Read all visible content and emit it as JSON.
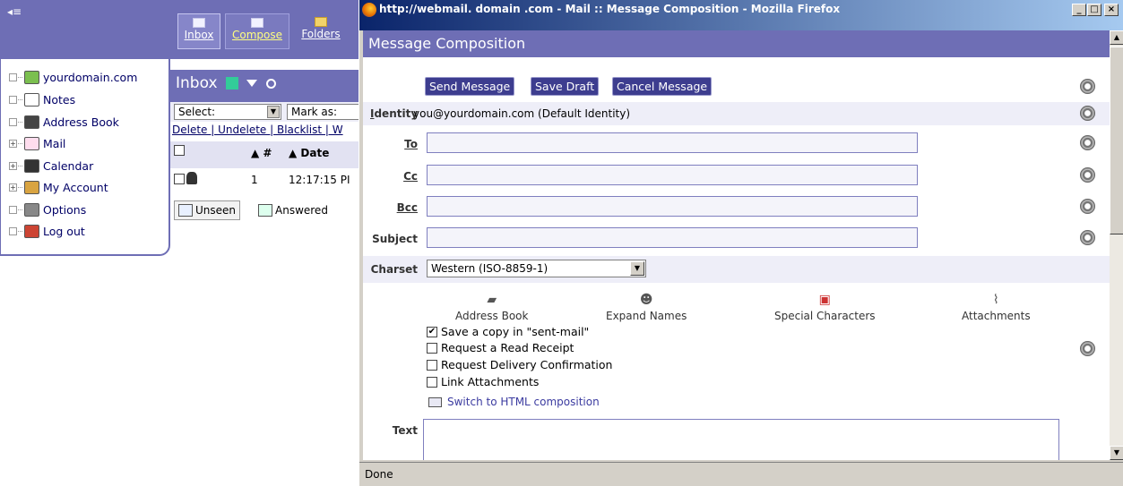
{
  "left_app": {
    "toolbar": {
      "inbox": "Inbox",
      "compose": "Compose",
      "folders": "Folders"
    },
    "tree": [
      {
        "label": "yourdomain.com",
        "expander": "",
        "icon": "domain-icon"
      },
      {
        "label": "Notes",
        "expander": "",
        "icon": "notes-icon"
      },
      {
        "label": "Address Book",
        "expander": "",
        "icon": "address-book-icon"
      },
      {
        "label": "Mail",
        "expander": "+",
        "icon": "mail-icon"
      },
      {
        "label": "Calendar",
        "expander": "+",
        "icon": "calendar-icon"
      },
      {
        "label": "My Account",
        "expander": "+",
        "icon": "account-icon"
      },
      {
        "label": "Options",
        "expander": "",
        "icon": "options-icon"
      },
      {
        "label": "Log out",
        "expander": "",
        "icon": "logout-icon"
      }
    ],
    "inbox": {
      "title": "Inbox",
      "select_label": "Select:",
      "mark_as_label": "Mark as:",
      "links": "Delete | Undelete | Blacklist | W",
      "col_num": "▲ #",
      "col_date": "▲ Date",
      "row_num": "1",
      "row_time": "12:17:15 PI",
      "legend_unseen": "Unseen",
      "legend_answered": "Answered"
    }
  },
  "window": {
    "title": "http://webmail. domain .com - Mail :: Message Composition - Mozilla Firefox",
    "status": "Done"
  },
  "compose": {
    "heading": "Message Composition",
    "buttons": {
      "send": "Send Message",
      "save": "Save Draft",
      "cancel": "Cancel Message"
    },
    "identity_label": "Identity",
    "identity_value": "you@yourdomain.com (Default Identity)",
    "to_label": "To",
    "cc_label": "Cc",
    "bcc_label": "Bcc",
    "subject_label": "Subject",
    "charset_label": "Charset",
    "charset_value": "Western (ISO-8859-1)",
    "tools": {
      "address_book": "Address Book",
      "expand_names": "Expand Names",
      "special_characters": "Special Characters",
      "attachments": "Attachments"
    },
    "options": {
      "save_copy": "Save a copy in \"sent-mail\"",
      "read_receipt": "Request a Read Receipt",
      "delivery_confirmation": "Request Delivery Confirmation",
      "link_attachments": "Link Attachments"
    },
    "switch_html": "Switch to HTML composition",
    "text_label": "Text"
  }
}
